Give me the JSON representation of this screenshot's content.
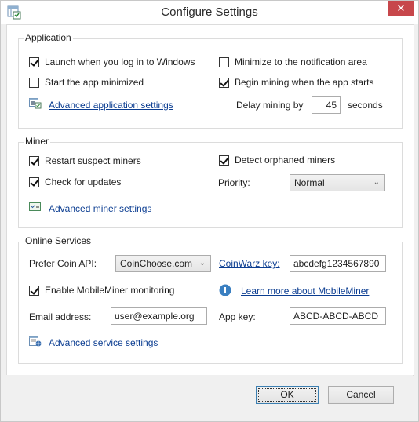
{
  "window": {
    "title": "Configure Settings",
    "close_label": "✕"
  },
  "application": {
    "label": "Application",
    "launch_on_login": {
      "label": "Launch when you log in to Windows",
      "checked": true
    },
    "start_minimized": {
      "label": "Start the app minimized",
      "checked": false
    },
    "minimize_to_tray": {
      "label": "Minimize to the notification area",
      "checked": false
    },
    "begin_mining": {
      "label": "Begin mining when the app starts",
      "checked": true
    },
    "delay_label": "Delay mining by",
    "delay_value": "45",
    "delay_unit": "seconds",
    "advanced_link": "Advanced application settings"
  },
  "miner": {
    "label": "Miner",
    "restart_suspect": {
      "label": "Restart suspect miners",
      "checked": true
    },
    "check_updates": {
      "label": "Check for updates",
      "checked": true
    },
    "detect_orphaned": {
      "label": "Detect orphaned miners",
      "checked": true
    },
    "priority_label": "Priority:",
    "priority_value": "Normal",
    "advanced_link": "Advanced miner settings"
  },
  "online": {
    "label": "Online Services",
    "coin_api_label": "Prefer Coin API:",
    "coin_api_value": "CoinChoose.com",
    "coinwarz_link": "CoinWarz key:",
    "coinwarz_value": "abcdefg1234567890",
    "mobileminer": {
      "label": "Enable MobileMiner monitoring",
      "checked": true
    },
    "learn_more_link": "Learn more about MobileMiner",
    "email_label": "Email address:",
    "email_value": "user@example.org",
    "app_key_label": "App key:",
    "app_key_value": "ABCD-ABCD-ABCD",
    "advanced_link": "Advanced service settings"
  },
  "footer": {
    "ok_label": "OK",
    "cancel_label": "Cancel"
  },
  "colors": {
    "close_button": "#c7474b",
    "link": "#0b3d91",
    "info_icon": "#3a7fc1"
  }
}
